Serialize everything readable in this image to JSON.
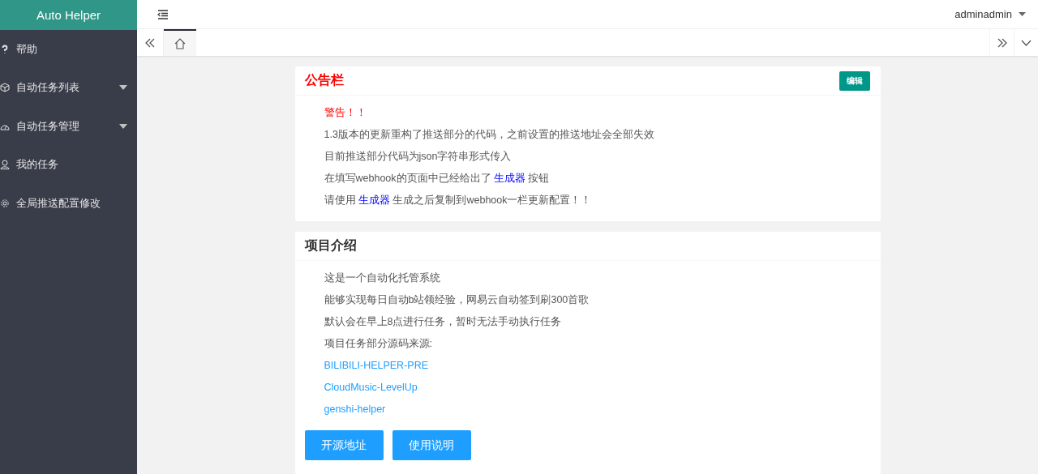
{
  "logo": "Auto Helper",
  "sidebar": {
    "items": [
      {
        "label": "帮助",
        "kind": "link"
      },
      {
        "label": "自动任务列表",
        "kind": "group",
        "expanded": false
      },
      {
        "label": "自动任务管理",
        "kind": "group",
        "expanded": false
      },
      {
        "label": "我的任务",
        "kind": "link"
      },
      {
        "label": "全局推送配置修改",
        "kind": "link"
      }
    ]
  },
  "header": {
    "user": "adminadmin"
  },
  "tabs": [
    {
      "kind": "home",
      "selected": true
    }
  ],
  "notice": {
    "title": "公告栏",
    "edit_button": "编辑",
    "lines": [
      {
        "kind": "warning",
        "parts": [
          {
            "text": "警告！！"
          }
        ]
      },
      {
        "kind": "plain",
        "parts": [
          {
            "text": "1.3版本的更新重构了推送部分的代码，之前设置的推送地址会全部失效"
          }
        ]
      },
      {
        "kind": "plain",
        "parts": [
          {
            "text": "目前推送部分代码为json字符串形式传入"
          }
        ]
      },
      {
        "kind": "plain",
        "parts": [
          {
            "text": "在填写webhook的页面中已经给出了 "
          },
          {
            "text": "生成器",
            "kind": "link"
          },
          {
            "text": " 按钮"
          }
        ]
      },
      {
        "kind": "plain",
        "parts": [
          {
            "text": "请使用 "
          },
          {
            "text": "生成器",
            "kind": "link"
          },
          {
            "text": " 生成之后复制到webhook一栏更新配置！！"
          }
        ]
      }
    ]
  },
  "intro": {
    "title": "项目介绍",
    "lines": [
      {
        "kind": "plain",
        "text": "这是一个自动化托管系统"
      },
      {
        "kind": "plain",
        "text": "能够实现每日自动b站领经验，网易云自动签到刷300首歌"
      },
      {
        "kind": "plain",
        "text": "默认会在早上8点进行任务，暂时无法手动执行任务"
      },
      {
        "kind": "plain",
        "text": "项目任务部分源码来源:"
      },
      {
        "kind": "link",
        "text": "BILIBILI-HELPER-PRE"
      },
      {
        "kind": "link",
        "text": "CloudMusic-LevelUp"
      },
      {
        "kind": "link",
        "text": "genshi-helper"
      }
    ],
    "buttons": [
      "开源地址",
      "使用说明"
    ]
  }
}
